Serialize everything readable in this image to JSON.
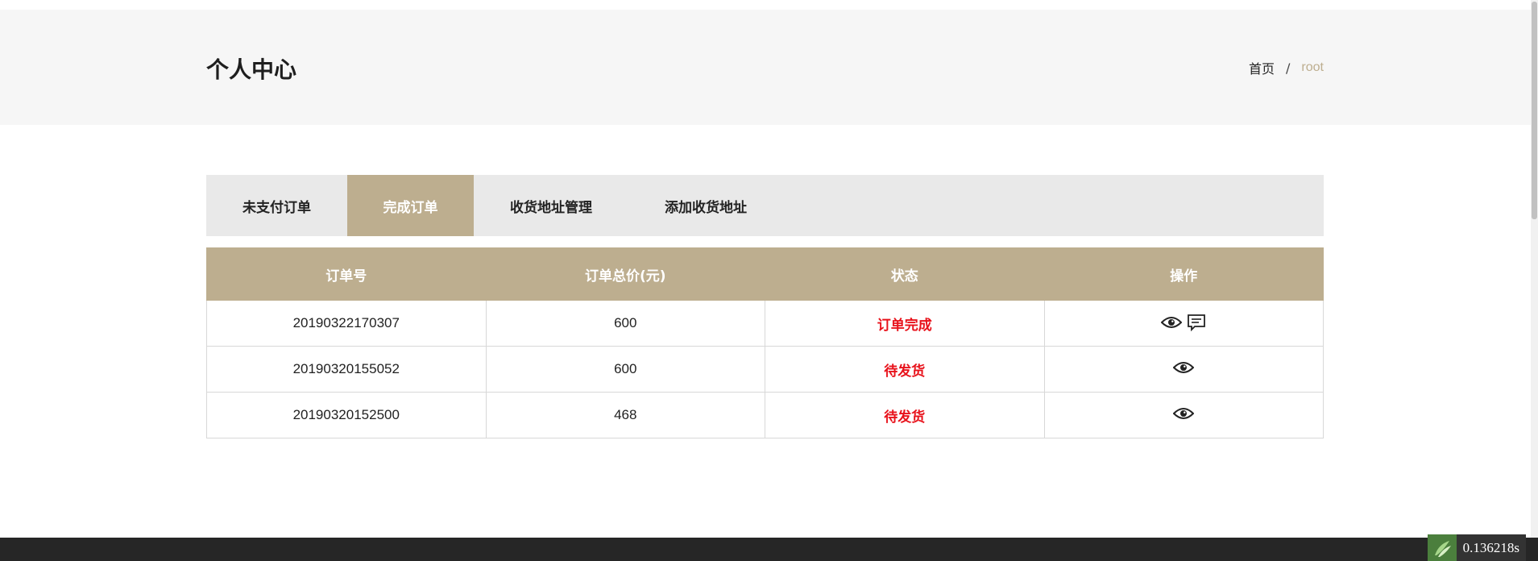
{
  "header": {
    "title": "个人中心",
    "breadcrumb": {
      "home": "首页",
      "separator": "/",
      "current": "root"
    }
  },
  "tabs": [
    {
      "label": "未支付订单",
      "active": false
    },
    {
      "label": "完成订单",
      "active": true
    },
    {
      "label": "收货地址管理",
      "active": false
    },
    {
      "label": "添加收货地址",
      "active": false
    }
  ],
  "table": {
    "columns": [
      "订单号",
      "订单总价(元)",
      "状态",
      "操作"
    ],
    "rows": [
      {
        "order_no": "20190322170307",
        "total": "600",
        "status": "订单完成",
        "actions": [
          "eye-icon",
          "comment-icon"
        ]
      },
      {
        "order_no": "20190320155052",
        "total": "600",
        "status": "待发货",
        "actions": [
          "eye-icon"
        ]
      },
      {
        "order_no": "20190320152500",
        "total": "468",
        "status": "待发货",
        "actions": [
          "eye-icon"
        ]
      }
    ]
  },
  "debug": {
    "elapsed": "0.136218s"
  },
  "colors": {
    "accent": "#bdae8f",
    "status_red": "#e8121b",
    "footer": "#262626"
  }
}
